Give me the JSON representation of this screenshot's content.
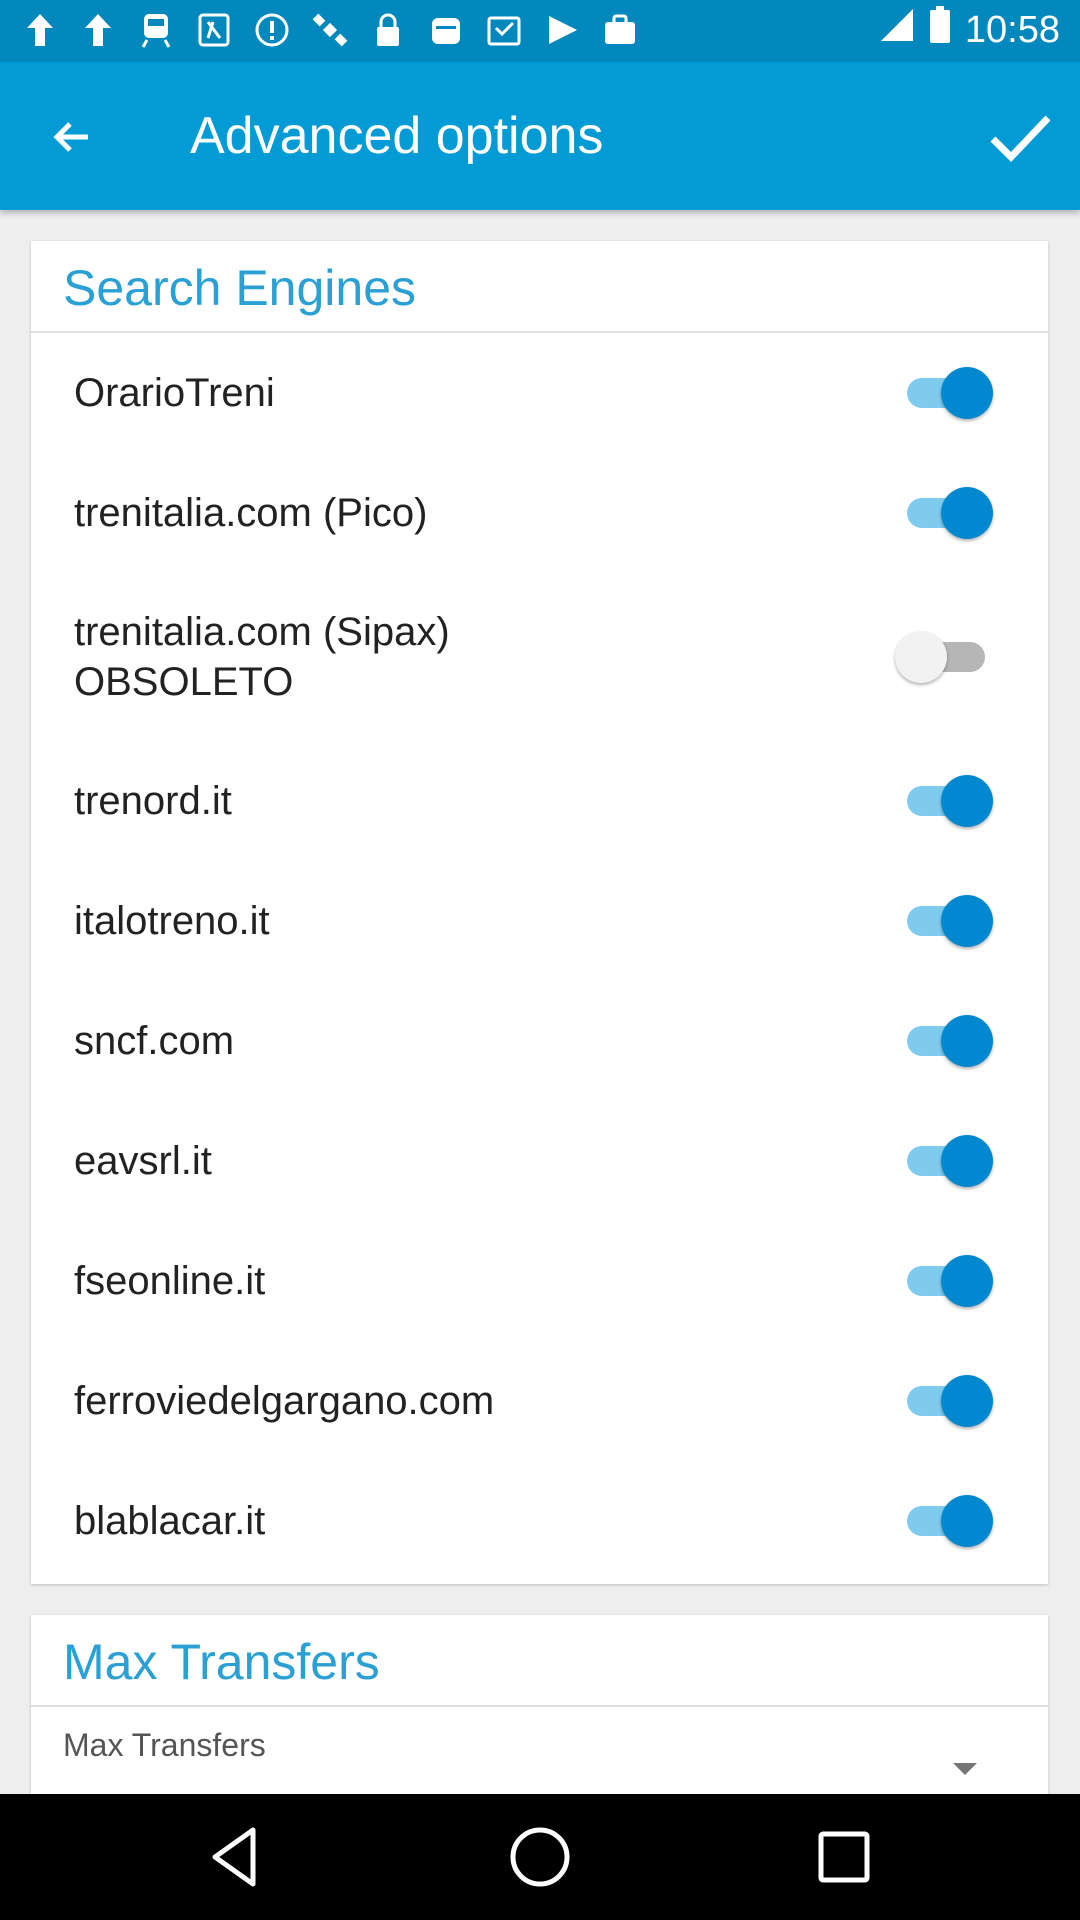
{
  "status_bar": {
    "time": "10:58",
    "icons": [
      "notification-arrow-icon",
      "notification-arrow-icon",
      "train-icon",
      "transit-icon",
      "alert-icon",
      "satellite-icon",
      "lock-icon",
      "calendar-icon",
      "inbox-icon",
      "play-store-icon",
      "briefcase-icon",
      "signal-icon",
      "battery-icon"
    ]
  },
  "app_bar": {
    "title": "Advanced options",
    "back_icon": "back-arrow-icon",
    "confirm_icon": "check-icon"
  },
  "search_engines": {
    "title": "Search Engines",
    "items": [
      {
        "label": "OrarioTreni",
        "enabled": true
      },
      {
        "label": "trenitalia.com (Pico)",
        "enabled": true
      },
      {
        "label": "trenitalia.com (Sipax)\nOBSOLETO",
        "enabled": false
      },
      {
        "label": "trenord.it",
        "enabled": true
      },
      {
        "label": "italotreno.it",
        "enabled": true
      },
      {
        "label": "sncf.com",
        "enabled": true
      },
      {
        "label": "eavsrl.it",
        "enabled": true
      },
      {
        "label": "fseonline.it",
        "enabled": true
      },
      {
        "label": "ferroviedelgargano.com",
        "enabled": true
      },
      {
        "label": "blablacar.it",
        "enabled": true
      }
    ]
  },
  "max_transfers": {
    "title": "Max Transfers",
    "label": "Max Transfers"
  },
  "colors": {
    "app_bar": "#039bd6",
    "status_bar": "#0288bd",
    "accent": "#0288d1",
    "section_title": "#2aa0d4"
  }
}
